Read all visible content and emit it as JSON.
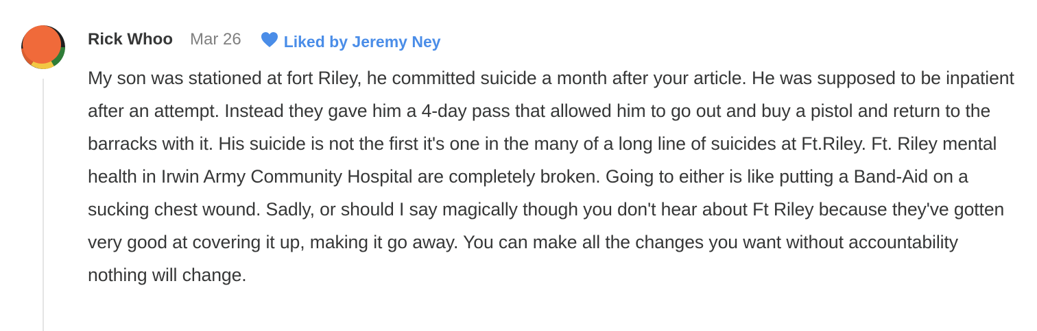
{
  "comment": {
    "author": "Rick Whoo",
    "date": "Mar 26",
    "liked_by": "Liked by Jeremy Ney",
    "body": "My son was stationed at fort Riley, he committed suicide a month after your article. He was supposed to be inpatient after an attempt. Instead they gave him a 4-day pass that allowed him to go out and buy a pistol and return to the barracks with it. His suicide is not the first it's one in the many of a long line of suicides at Ft.Riley. Ft. Riley mental health in Irwin Army Community Hospital are completely broken. Going to either is like putting a Band-Aid on a sucking chest wound. Sadly, or should I say magically though you don't hear about Ft Riley because they've gotten very good at covering it up, making it go away. You can make all the changes you want without accountability nothing will change.",
    "liked_icon": "heart-icon"
  },
  "colors": {
    "text": "#363737",
    "muted": "#808080",
    "accent": "#4a8de8",
    "thread_line": "#e4e4e4",
    "avatar_orange": "#f06a3a"
  }
}
